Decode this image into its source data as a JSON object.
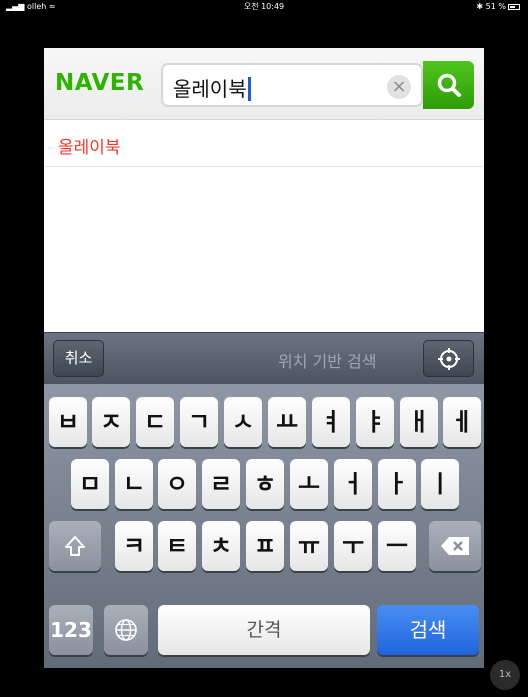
{
  "status": {
    "carrier": "olleh",
    "time": "오전 10:49",
    "battery": "51 %"
  },
  "header": {
    "logo": "NAVER",
    "query": "올레이북",
    "clear_glyph": "×"
  },
  "suggestions": [
    "올레이북"
  ],
  "accessory": {
    "cancel_label": "취소",
    "location_label": "위치 기반 검색"
  },
  "keyboard": {
    "row1": [
      "ㅂ",
      "ㅈ",
      "ㄷ",
      "ㄱ",
      "ㅅ",
      "ㅛ",
      "ㅕ",
      "ㅑ",
      "ㅐ",
      "ㅔ"
    ],
    "row2": [
      "ㅁ",
      "ㄴ",
      "ㅇ",
      "ㄹ",
      "ㅎ",
      "ㅗ",
      "ㅓ",
      "ㅏ",
      "ㅣ"
    ],
    "row3": [
      "ㅋ",
      "ㅌ",
      "ㅊ",
      "ㅍ",
      "ㅠ",
      "ㅜ",
      "ㅡ"
    ],
    "num_label": "123",
    "space_label": "간격",
    "search_label": "검색"
  },
  "zoom": "1x",
  "colors": {
    "brand_green": "#2db400",
    "suggestion_red": "#ef3a2a",
    "search_blue": "#2064dc"
  }
}
